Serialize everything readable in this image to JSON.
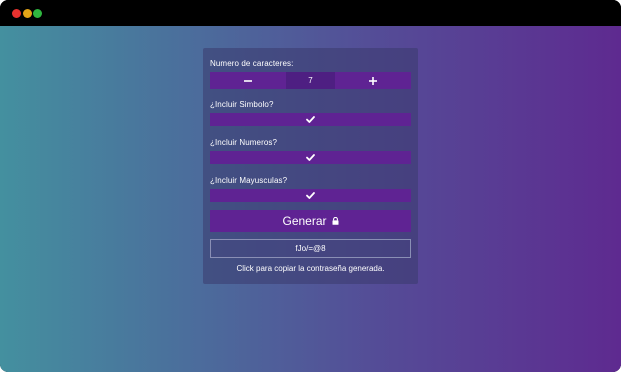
{
  "window": {
    "controls": [
      "close",
      "minimize",
      "maximize"
    ]
  },
  "form": {
    "length_label": "Numero de caracteres:",
    "length_value": "7",
    "decrement_icon": "minus-icon",
    "increment_icon": "plus-icon",
    "options": [
      {
        "label": "¿Incluir Simbolo?",
        "checked": true
      },
      {
        "label": "¿Incluir Numeros?",
        "checked": true
      },
      {
        "label": "¿Incluir Mayusculas?",
        "checked": true
      }
    ],
    "generate_label": "Generar",
    "generate_icon": "lock-icon",
    "password_value": "fJo/=@8",
    "copy_hint": "Click para copiar la contraseña generada."
  },
  "colors": {
    "background_start": "#44909f",
    "background_end": "#5e2a90",
    "accent": "#5f2393",
    "accent_dark": "#4e1f82"
  }
}
